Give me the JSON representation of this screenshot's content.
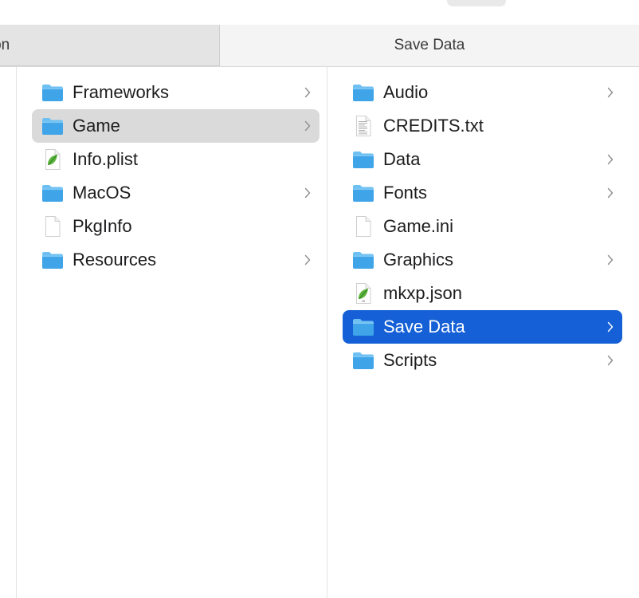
{
  "header": {
    "left_tab_label": "ation",
    "right_tab_label": "Save Data"
  },
  "middle_column": {
    "items": [
      {
        "label": "Frameworks",
        "icon": "folder-icon",
        "has_children": true,
        "state": "normal"
      },
      {
        "label": "Game",
        "icon": "folder-icon",
        "has_children": true,
        "state": "selected-inactive"
      },
      {
        "label": "Info.plist",
        "icon": "plist-file-icon",
        "has_children": false,
        "state": "normal"
      },
      {
        "label": "MacOS",
        "icon": "folder-icon",
        "has_children": true,
        "state": "normal"
      },
      {
        "label": "PkgInfo",
        "icon": "blank-file-icon",
        "has_children": false,
        "state": "normal"
      },
      {
        "label": "Resources",
        "icon": "folder-icon",
        "has_children": true,
        "state": "normal"
      }
    ]
  },
  "right_column": {
    "items": [
      {
        "label": "Audio",
        "icon": "folder-icon",
        "has_children": true,
        "state": "normal"
      },
      {
        "label": "CREDITS.txt",
        "icon": "text-file-icon",
        "has_children": false,
        "state": "normal"
      },
      {
        "label": "Data",
        "icon": "folder-icon",
        "has_children": true,
        "state": "normal"
      },
      {
        "label": "Fonts",
        "icon": "folder-icon",
        "has_children": true,
        "state": "normal"
      },
      {
        "label": "Game.ini",
        "icon": "blank-file-icon",
        "has_children": false,
        "state": "normal"
      },
      {
        "label": "Graphics",
        "icon": "folder-icon",
        "has_children": true,
        "state": "normal"
      },
      {
        "label": "mkxp.json",
        "icon": "json-file-icon",
        "has_children": false,
        "state": "normal"
      },
      {
        "label": "Save Data",
        "icon": "folder-icon",
        "has_children": true,
        "state": "selected-active"
      },
      {
        "label": "Scripts",
        "icon": "folder-icon",
        "has_children": true,
        "state": "normal"
      }
    ]
  },
  "colors": {
    "selection_active": "#1560d6",
    "selection_inactive": "#dadada",
    "folder_blue": "#3fa4e8",
    "folder_tab_blue": "#6ec0f2"
  }
}
